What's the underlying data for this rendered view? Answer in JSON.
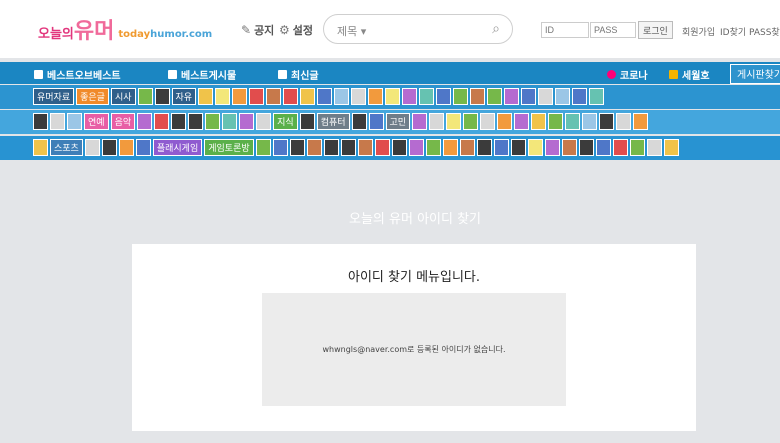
{
  "header": {
    "logo_ko_1": "오늘의",
    "logo_ko_2": "유머",
    "logo_en_1": "today",
    "logo_en_2": "humor.com",
    "notice": "공지",
    "settings": "설정",
    "search": {
      "scope": "제목 ▾",
      "query": "",
      "icon": "search-icon"
    },
    "login": {
      "id_placeholder": "ID",
      "pass_placeholder": "PASS",
      "button": "로그인"
    },
    "links": [
      "회원가입",
      "ID찾기",
      "PASS찾"
    ]
  },
  "menu": {
    "items": [
      "베스트오브베스트",
      "베스트게시물",
      "최신글"
    ],
    "right_items": [
      "코로나",
      "세월호"
    ],
    "board_button": "게시판찾기"
  },
  "categories": {
    "row1_labels": [
      "유머자료",
      "좋은글",
      "시사",
      "자유"
    ],
    "row2_labels": [
      "연예",
      "음악",
      "지식",
      "컴퓨터",
      "고민"
    ],
    "row3_labels": [
      "스포츠",
      "플래시게임",
      "게임토론방"
    ]
  },
  "main": {
    "title": "오늘의 유머 아이디 찾기",
    "heading": "아이디 찾기 메뉴입니다.",
    "message": "whwngls@naver.com로 등록된 아이디가 없습니다."
  }
}
